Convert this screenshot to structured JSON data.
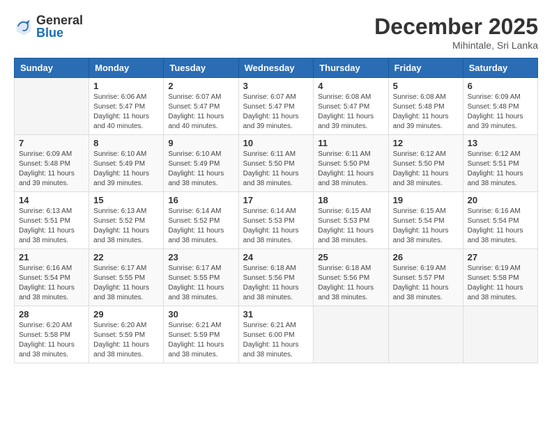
{
  "logo": {
    "general": "General",
    "blue": "Blue"
  },
  "title": "December 2025",
  "location": "Mihintale, Sri Lanka",
  "days_header": [
    "Sunday",
    "Monday",
    "Tuesday",
    "Wednesday",
    "Thursday",
    "Friday",
    "Saturday"
  ],
  "weeks": [
    [
      {
        "day": "",
        "sunrise": "",
        "sunset": "",
        "daylight": ""
      },
      {
        "day": "1",
        "sunrise": "Sunrise: 6:06 AM",
        "sunset": "Sunset: 5:47 PM",
        "daylight": "Daylight: 11 hours and 40 minutes."
      },
      {
        "day": "2",
        "sunrise": "Sunrise: 6:07 AM",
        "sunset": "Sunset: 5:47 PM",
        "daylight": "Daylight: 11 hours and 40 minutes."
      },
      {
        "day": "3",
        "sunrise": "Sunrise: 6:07 AM",
        "sunset": "Sunset: 5:47 PM",
        "daylight": "Daylight: 11 hours and 39 minutes."
      },
      {
        "day": "4",
        "sunrise": "Sunrise: 6:08 AM",
        "sunset": "Sunset: 5:47 PM",
        "daylight": "Daylight: 11 hours and 39 minutes."
      },
      {
        "day": "5",
        "sunrise": "Sunrise: 6:08 AM",
        "sunset": "Sunset: 5:48 PM",
        "daylight": "Daylight: 11 hours and 39 minutes."
      },
      {
        "day": "6",
        "sunrise": "Sunrise: 6:09 AM",
        "sunset": "Sunset: 5:48 PM",
        "daylight": "Daylight: 11 hours and 39 minutes."
      }
    ],
    [
      {
        "day": "7",
        "sunrise": "Sunrise: 6:09 AM",
        "sunset": "Sunset: 5:48 PM",
        "daylight": "Daylight: 11 hours and 39 minutes."
      },
      {
        "day": "8",
        "sunrise": "Sunrise: 6:10 AM",
        "sunset": "Sunset: 5:49 PM",
        "daylight": "Daylight: 11 hours and 39 minutes."
      },
      {
        "day": "9",
        "sunrise": "Sunrise: 6:10 AM",
        "sunset": "Sunset: 5:49 PM",
        "daylight": "Daylight: 11 hours and 38 minutes."
      },
      {
        "day": "10",
        "sunrise": "Sunrise: 6:11 AM",
        "sunset": "Sunset: 5:50 PM",
        "daylight": "Daylight: 11 hours and 38 minutes."
      },
      {
        "day": "11",
        "sunrise": "Sunrise: 6:11 AM",
        "sunset": "Sunset: 5:50 PM",
        "daylight": "Daylight: 11 hours and 38 minutes."
      },
      {
        "day": "12",
        "sunrise": "Sunrise: 6:12 AM",
        "sunset": "Sunset: 5:50 PM",
        "daylight": "Daylight: 11 hours and 38 minutes."
      },
      {
        "day": "13",
        "sunrise": "Sunrise: 6:12 AM",
        "sunset": "Sunset: 5:51 PM",
        "daylight": "Daylight: 11 hours and 38 minutes."
      }
    ],
    [
      {
        "day": "14",
        "sunrise": "Sunrise: 6:13 AM",
        "sunset": "Sunset: 5:51 PM",
        "daylight": "Daylight: 11 hours and 38 minutes."
      },
      {
        "day": "15",
        "sunrise": "Sunrise: 6:13 AM",
        "sunset": "Sunset: 5:52 PM",
        "daylight": "Daylight: 11 hours and 38 minutes."
      },
      {
        "day": "16",
        "sunrise": "Sunrise: 6:14 AM",
        "sunset": "Sunset: 5:52 PM",
        "daylight": "Daylight: 11 hours and 38 minutes."
      },
      {
        "day": "17",
        "sunrise": "Sunrise: 6:14 AM",
        "sunset": "Sunset: 5:53 PM",
        "daylight": "Daylight: 11 hours and 38 minutes."
      },
      {
        "day": "18",
        "sunrise": "Sunrise: 6:15 AM",
        "sunset": "Sunset: 5:53 PM",
        "daylight": "Daylight: 11 hours and 38 minutes."
      },
      {
        "day": "19",
        "sunrise": "Sunrise: 6:15 AM",
        "sunset": "Sunset: 5:54 PM",
        "daylight": "Daylight: 11 hours and 38 minutes."
      },
      {
        "day": "20",
        "sunrise": "Sunrise: 6:16 AM",
        "sunset": "Sunset: 5:54 PM",
        "daylight": "Daylight: 11 hours and 38 minutes."
      }
    ],
    [
      {
        "day": "21",
        "sunrise": "Sunrise: 6:16 AM",
        "sunset": "Sunset: 5:54 PM",
        "daylight": "Daylight: 11 hours and 38 minutes."
      },
      {
        "day": "22",
        "sunrise": "Sunrise: 6:17 AM",
        "sunset": "Sunset: 5:55 PM",
        "daylight": "Daylight: 11 hours and 38 minutes."
      },
      {
        "day": "23",
        "sunrise": "Sunrise: 6:17 AM",
        "sunset": "Sunset: 5:55 PM",
        "daylight": "Daylight: 11 hours and 38 minutes."
      },
      {
        "day": "24",
        "sunrise": "Sunrise: 6:18 AM",
        "sunset": "Sunset: 5:56 PM",
        "daylight": "Daylight: 11 hours and 38 minutes."
      },
      {
        "day": "25",
        "sunrise": "Sunrise: 6:18 AM",
        "sunset": "Sunset: 5:56 PM",
        "daylight": "Daylight: 11 hours and 38 minutes."
      },
      {
        "day": "26",
        "sunrise": "Sunrise: 6:19 AM",
        "sunset": "Sunset: 5:57 PM",
        "daylight": "Daylight: 11 hours and 38 minutes."
      },
      {
        "day": "27",
        "sunrise": "Sunrise: 6:19 AM",
        "sunset": "Sunset: 5:58 PM",
        "daylight": "Daylight: 11 hours and 38 minutes."
      }
    ],
    [
      {
        "day": "28",
        "sunrise": "Sunrise: 6:20 AM",
        "sunset": "Sunset: 5:58 PM",
        "daylight": "Daylight: 11 hours and 38 minutes."
      },
      {
        "day": "29",
        "sunrise": "Sunrise: 6:20 AM",
        "sunset": "Sunset: 5:59 PM",
        "daylight": "Daylight: 11 hours and 38 minutes."
      },
      {
        "day": "30",
        "sunrise": "Sunrise: 6:21 AM",
        "sunset": "Sunset: 5:59 PM",
        "daylight": "Daylight: 11 hours and 38 minutes."
      },
      {
        "day": "31",
        "sunrise": "Sunrise: 6:21 AM",
        "sunset": "Sunset: 6:00 PM",
        "daylight": "Daylight: 11 hours and 38 minutes."
      },
      {
        "day": "",
        "sunrise": "",
        "sunset": "",
        "daylight": ""
      },
      {
        "day": "",
        "sunrise": "",
        "sunset": "",
        "daylight": ""
      },
      {
        "day": "",
        "sunrise": "",
        "sunset": "",
        "daylight": ""
      }
    ]
  ]
}
